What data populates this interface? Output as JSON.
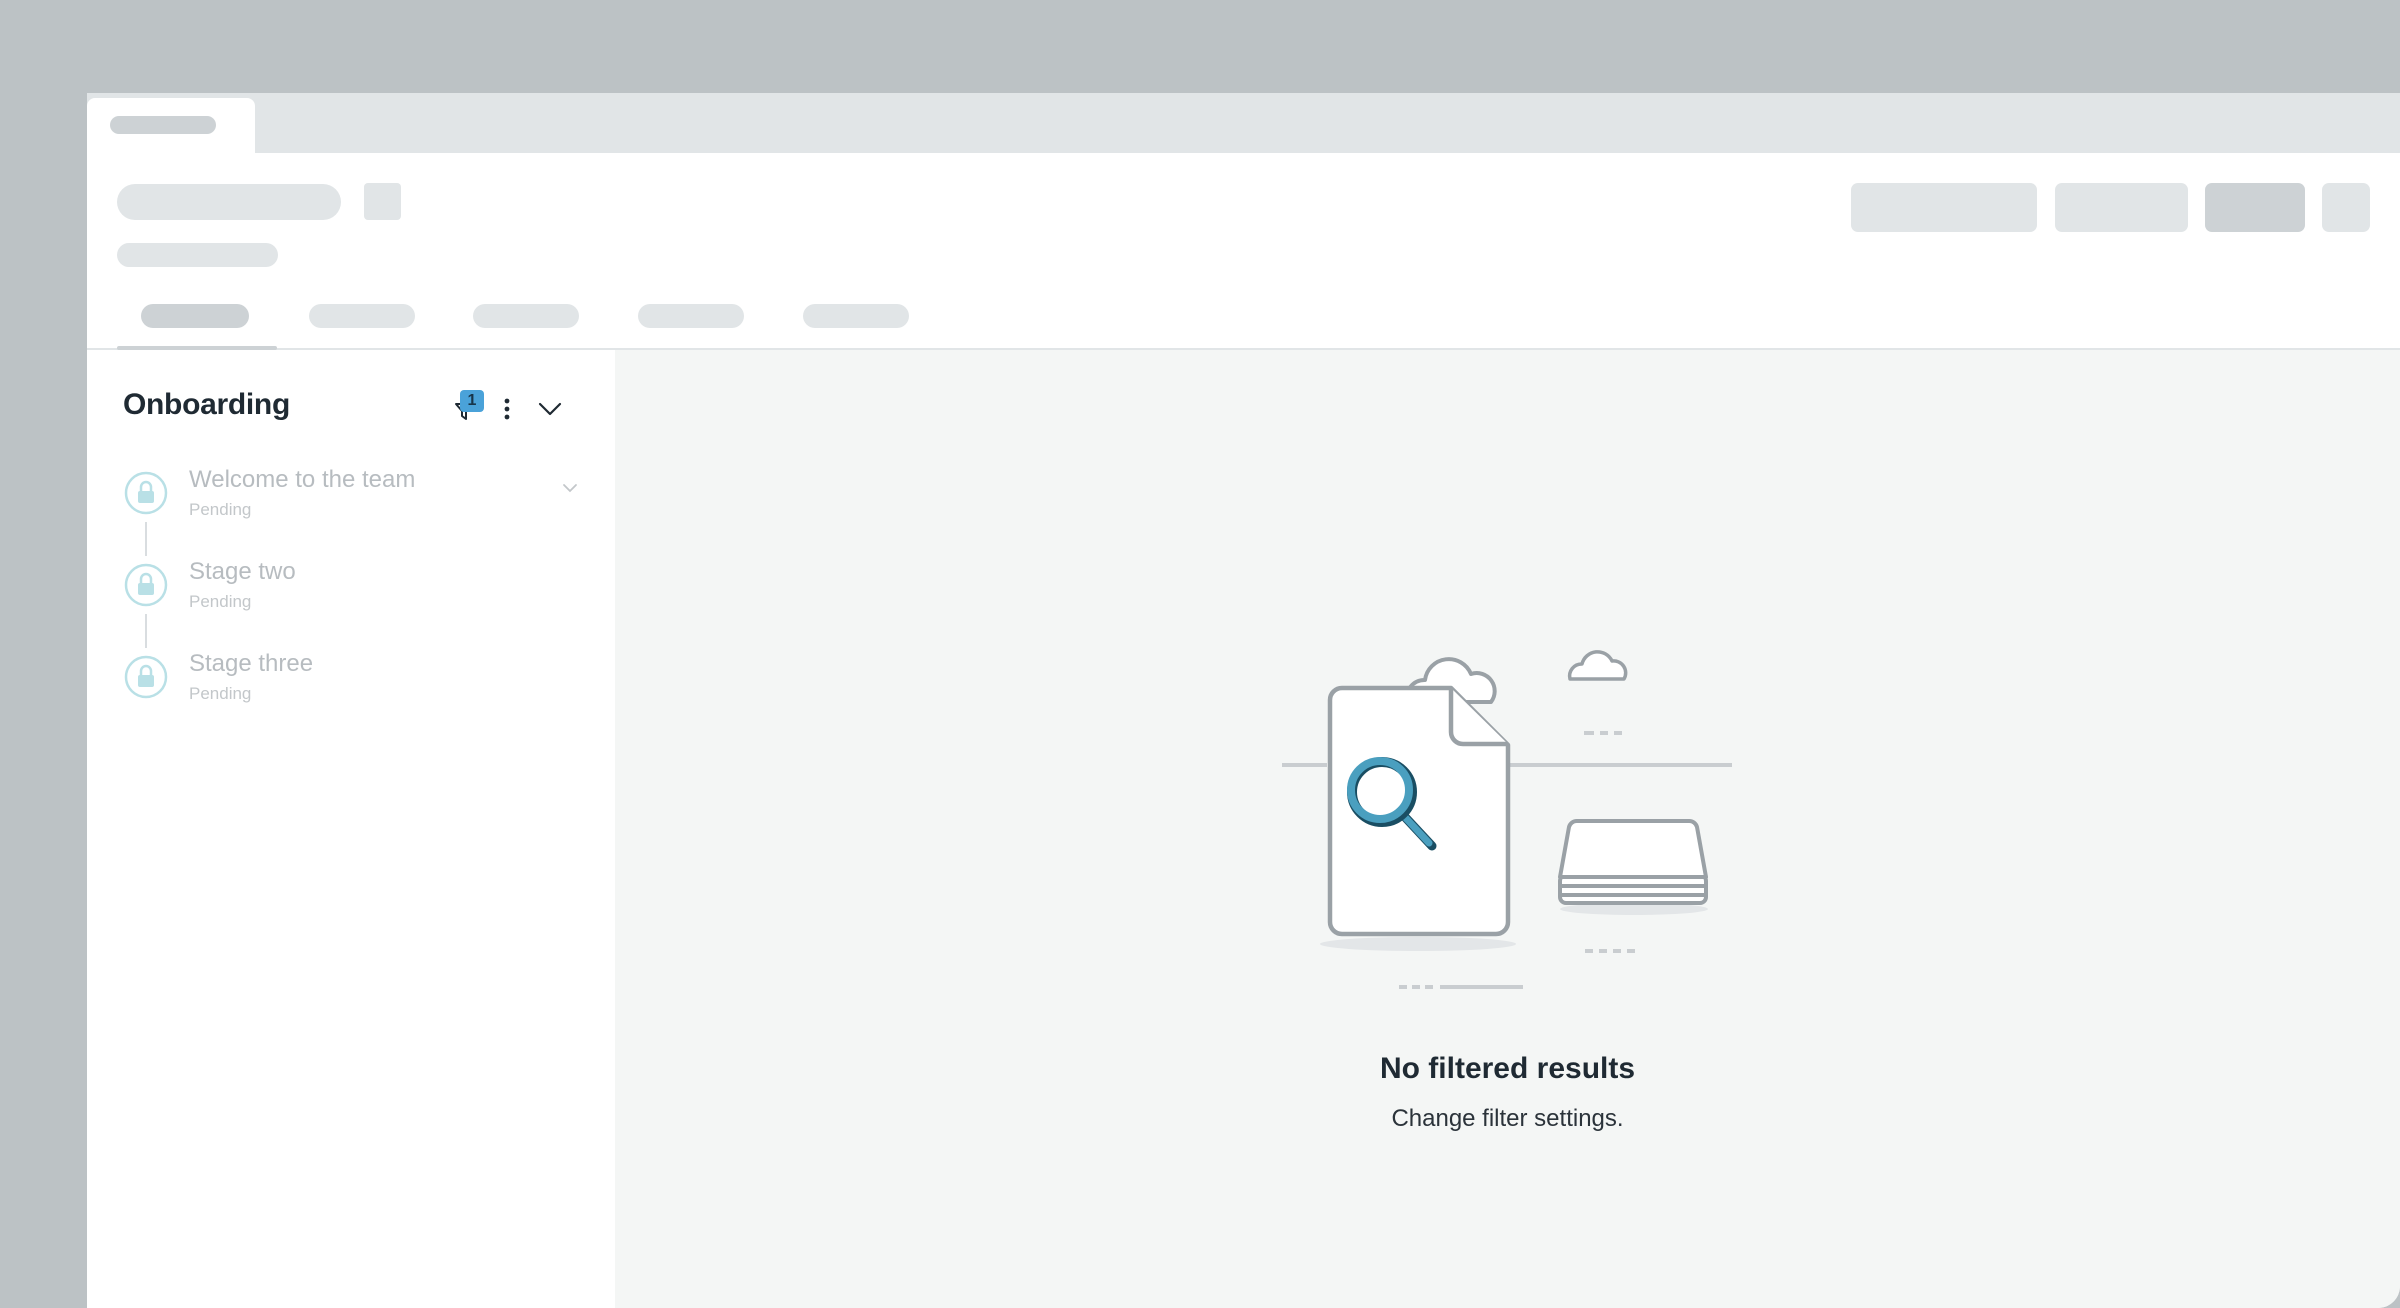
{
  "sidebar": {
    "title": "Onboarding",
    "filter_count": "1",
    "stages": [
      {
        "name": "Welcome to the team",
        "status": "Pending",
        "expandable": true
      },
      {
        "name": "Stage two",
        "status": "Pending",
        "expandable": false
      },
      {
        "name": "Stage three",
        "status": "Pending",
        "expandable": false
      }
    ]
  },
  "empty_state": {
    "title": "No filtered results",
    "subtitle": "Change filter settings."
  },
  "colors": {
    "accent": "#4aa2d9",
    "magnifier": "#4a9fbf",
    "lock_icon": "#a9d8e0",
    "frame": "#bcc2c5"
  },
  "icons": [
    "filter-icon",
    "kebab-menu-icon",
    "chevron-down-icon",
    "lock-icon",
    "magnifier-document-icon"
  ]
}
